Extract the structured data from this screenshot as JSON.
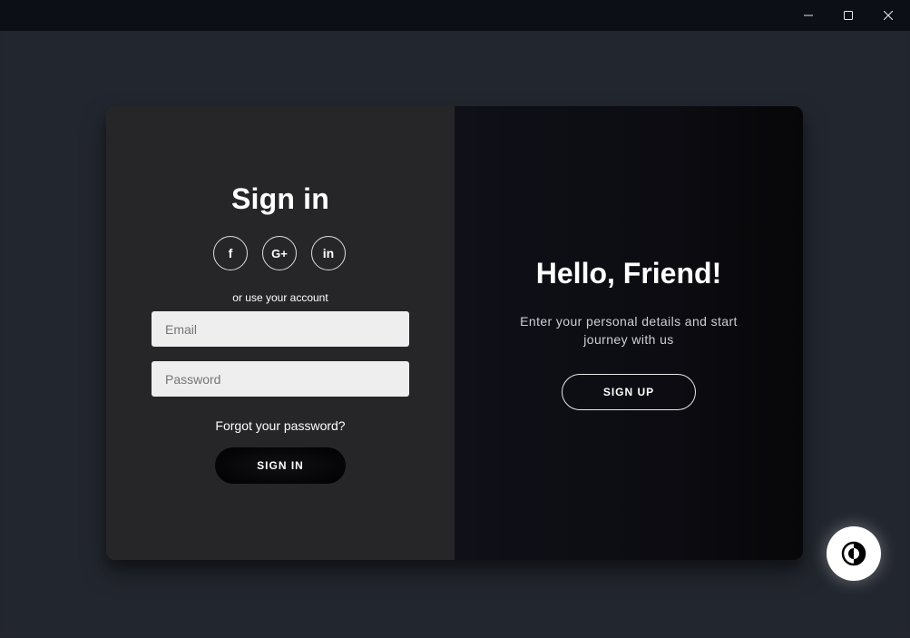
{
  "window": {
    "minimize_icon": "minimize-icon",
    "maximize_icon": "maximize-icon",
    "close_icon": "close-icon"
  },
  "signin": {
    "title": "Sign in",
    "socials": [
      {
        "name": "facebook-icon",
        "glyph": "f"
      },
      {
        "name": "google-plus-icon",
        "glyph": "G+"
      },
      {
        "name": "linkedin-icon",
        "glyph": "in"
      }
    ],
    "or_text": "or use your account",
    "email_placeholder": "Email",
    "password_placeholder": "Password",
    "forgot_text": "Forgot your password?",
    "button_label": "SIGN IN"
  },
  "overlay": {
    "title": "Hello, Friend!",
    "description": "Enter your personal details and start journey with us",
    "button_label": "SIGN UP"
  },
  "theme_toggle": {
    "icon": "contrast-icon"
  },
  "colors": {
    "background": "#22262e",
    "left_panel": "#262628",
    "right_panel": "#0c0c12",
    "input_bg": "#eeeeee",
    "text": "#ffffff"
  }
}
